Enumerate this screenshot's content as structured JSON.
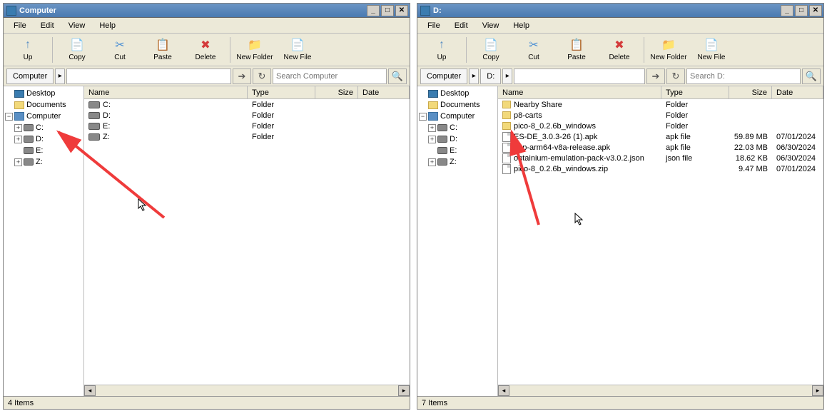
{
  "left": {
    "title": "Computer",
    "menu": [
      "File",
      "Edit",
      "View",
      "Help"
    ],
    "toolbar": [
      {
        "icon": "↑",
        "label": "Up",
        "color": "#5a8fc4"
      },
      {
        "icon": "📄",
        "label": "Copy",
        "color": "#d9b65c"
      },
      {
        "icon": "✂",
        "label": "Cut",
        "color": "#4a8fd4"
      },
      {
        "icon": "📋",
        "label": "Paste",
        "color": "#d9b65c"
      },
      {
        "icon": "✖",
        "label": "Delete",
        "color": "#d43a3a"
      },
      {
        "icon": "📁",
        "label": "New Folder",
        "color": "#d9b65c"
      },
      {
        "icon": "📄",
        "label": "New File",
        "color": "#d9b65c"
      }
    ],
    "breadcrumbs": [
      "Computer"
    ],
    "search_placeholder": "Search Computer",
    "tree": [
      {
        "indent": 0,
        "exp": "",
        "icon": "folder-blue",
        "label": "Desktop"
      },
      {
        "indent": 0,
        "exp": "",
        "icon": "folder-yellow",
        "label": "Documents"
      },
      {
        "indent": 0,
        "exp": "−",
        "icon": "computer",
        "label": "Computer"
      },
      {
        "indent": 1,
        "exp": "+",
        "icon": "drive",
        "label": "C:"
      },
      {
        "indent": 1,
        "exp": "+",
        "icon": "drive",
        "label": "D:"
      },
      {
        "indent": 1,
        "exp": "",
        "icon": "drive",
        "label": "E:"
      },
      {
        "indent": 1,
        "exp": "+",
        "icon": "drive",
        "label": "Z:"
      }
    ],
    "columns": [
      "Name",
      "Type",
      "Size",
      "Date"
    ],
    "rows": [
      {
        "icon": "drive",
        "name": "C:",
        "type": "Folder",
        "size": "",
        "date": ""
      },
      {
        "icon": "drive",
        "name": "D:",
        "type": "Folder",
        "size": "",
        "date": ""
      },
      {
        "icon": "drive",
        "name": "E:",
        "type": "Folder",
        "size": "",
        "date": ""
      },
      {
        "icon": "drive",
        "name": "Z:",
        "type": "Folder",
        "size": "",
        "date": ""
      }
    ],
    "status": "4 Items"
  },
  "right": {
    "title": "D:",
    "menu": [
      "File",
      "Edit",
      "View",
      "Help"
    ],
    "toolbar": [
      {
        "icon": "↑",
        "label": "Up",
        "color": "#5a8fc4"
      },
      {
        "icon": "📄",
        "label": "Copy",
        "color": "#d9b65c"
      },
      {
        "icon": "✂",
        "label": "Cut",
        "color": "#4a8fd4"
      },
      {
        "icon": "📋",
        "label": "Paste",
        "color": "#d9b65c"
      },
      {
        "icon": "✖",
        "label": "Delete",
        "color": "#d43a3a"
      },
      {
        "icon": "📁",
        "label": "New Folder",
        "color": "#d9b65c"
      },
      {
        "icon": "📄",
        "label": "New File",
        "color": "#d9b65c"
      }
    ],
    "breadcrumbs": [
      "Computer",
      "D:"
    ],
    "search_placeholder": "Search D:",
    "tree": [
      {
        "indent": 0,
        "exp": "",
        "icon": "folder-blue",
        "label": "Desktop"
      },
      {
        "indent": 0,
        "exp": "",
        "icon": "folder-yellow",
        "label": "Documents"
      },
      {
        "indent": 0,
        "exp": "−",
        "icon": "computer",
        "label": "Computer"
      },
      {
        "indent": 1,
        "exp": "+",
        "icon": "drive",
        "label": "C:"
      },
      {
        "indent": 1,
        "exp": "+",
        "icon": "drive",
        "label": "D:"
      },
      {
        "indent": 1,
        "exp": "",
        "icon": "drive",
        "label": "E:"
      },
      {
        "indent": 1,
        "exp": "+",
        "icon": "drive",
        "label": "Z:"
      }
    ],
    "columns": [
      "Name",
      "Type",
      "Size",
      "Date"
    ],
    "rows": [
      {
        "icon": "folder",
        "name": "Nearby Share",
        "type": "Folder",
        "size": "",
        "date": ""
      },
      {
        "icon": "folder",
        "name": "p8-carts",
        "type": "Folder",
        "size": "",
        "date": ""
      },
      {
        "icon": "folder",
        "name": "pico-8_0.2.6b_windows",
        "type": "Folder",
        "size": "",
        "date": ""
      },
      {
        "icon": "file",
        "name": "ES-DE_3.0.3-26 (1).apk",
        "type": "apk file",
        "size": "59.89 MB",
        "date": "07/01/2024"
      },
      {
        "icon": "file",
        "name": "app-arm64-v8a-release.apk",
        "type": "apk file",
        "size": "22.03 MB",
        "date": "06/30/2024"
      },
      {
        "icon": "file",
        "name": "obtainium-emulation-pack-v3.0.2.json",
        "type": "json file",
        "size": "18.62 KB",
        "date": "06/30/2024"
      },
      {
        "icon": "file",
        "name": "pico-8_0.2.6b_windows.zip",
        "type": "",
        "size": "9.47 MB",
        "date": "07/01/2024"
      }
    ],
    "status": "7 Items"
  }
}
